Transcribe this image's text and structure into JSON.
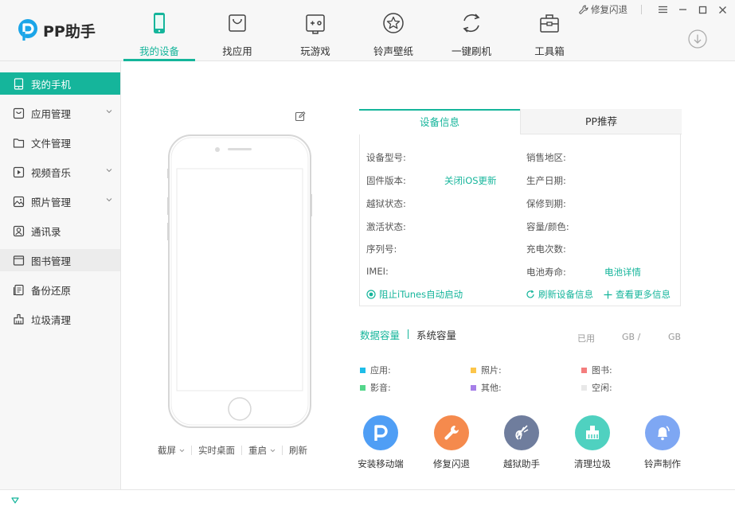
{
  "app": {
    "logo_text": "PP助手"
  },
  "window_controls": {
    "fix_label": "修复闪退"
  },
  "nav": [
    {
      "label": "我的设备",
      "icon": "phone-icon",
      "active": true
    },
    {
      "label": "找应用",
      "icon": "bag-icon"
    },
    {
      "label": "玩游戏",
      "icon": "gamepad-icon"
    },
    {
      "label": "铃声壁纸",
      "icon": "star-icon"
    },
    {
      "label": "一键刷机",
      "icon": "refresh-icon"
    },
    {
      "label": "工具箱",
      "icon": "toolbox-icon"
    }
  ],
  "sidebar": [
    {
      "label": "我的手机",
      "icon": "phone-icon",
      "active": true
    },
    {
      "label": "应用管理",
      "icon": "bag-icon",
      "expandable": true
    },
    {
      "label": "文件管理",
      "icon": "folder-icon"
    },
    {
      "label": "视频音乐",
      "icon": "play-icon",
      "expandable": true
    },
    {
      "label": "照片管理",
      "icon": "image-icon",
      "expandable": true
    },
    {
      "label": "通讯录",
      "icon": "contacts-icon"
    },
    {
      "label": "图书管理",
      "icon": "book-icon",
      "hovered": true
    },
    {
      "label": "备份还原",
      "icon": "backup-icon"
    },
    {
      "label": "垃圾清理",
      "icon": "broom-icon"
    }
  ],
  "phone_actions": [
    "截屏",
    "实时桌面",
    "重启",
    "刷新"
  ],
  "info": {
    "tabs": [
      "设备信息",
      "PP推荐"
    ],
    "left": [
      {
        "label": "设备型号:"
      },
      {
        "label": "固件版本:",
        "link": "关闭iOS更新"
      },
      {
        "label": "越狱状态:"
      },
      {
        "label": "激活状态:"
      },
      {
        "label": "序列号:"
      },
      {
        "label": "IMEI:"
      }
    ],
    "right": [
      {
        "label": "销售地区:"
      },
      {
        "label": "生产日期:"
      },
      {
        "label": "保修到期:"
      },
      {
        "label": "容量/颜色:"
      },
      {
        "label": "充电次数:"
      },
      {
        "label": "电池寿命:",
        "link": "电池详情"
      }
    ],
    "actions": {
      "itunes": "阻止iTunes自动启动",
      "refresh": "刷新设备信息",
      "more": "查看更多信息"
    }
  },
  "capacity": {
    "tabs": [
      "数据容量",
      "系统容量"
    ],
    "used_label": "已用",
    "unit_a": "GB /",
    "unit_b": "GB",
    "legend": [
      {
        "label": "应用:",
        "color": "#1ebde8"
      },
      {
        "label": "照片:",
        "color": "#fcc54a"
      },
      {
        "label": "图书:",
        "color": "#f47d7d"
      },
      {
        "label": "影音:",
        "color": "#54d68b"
      },
      {
        "label": "其他:",
        "color": "#a67fe8"
      },
      {
        "label": "空闲:",
        "color": "#e8e8e8"
      }
    ]
  },
  "tools": [
    {
      "label": "安装移动端",
      "color": "#4f9ef5",
      "icon": "pp-install-icon"
    },
    {
      "label": "修复闪退",
      "color": "#f58a4d",
      "icon": "wrench-icon"
    },
    {
      "label": "越狱助手",
      "color": "#6f7d9d",
      "icon": "jailbreak-icon"
    },
    {
      "label": "清理垃圾",
      "color": "#4fd1c0",
      "icon": "clean-icon"
    },
    {
      "label": "铃声制作",
      "color": "#7ea7f3",
      "icon": "bell-icon"
    }
  ],
  "colors": {
    "accent": "#15b59b"
  }
}
